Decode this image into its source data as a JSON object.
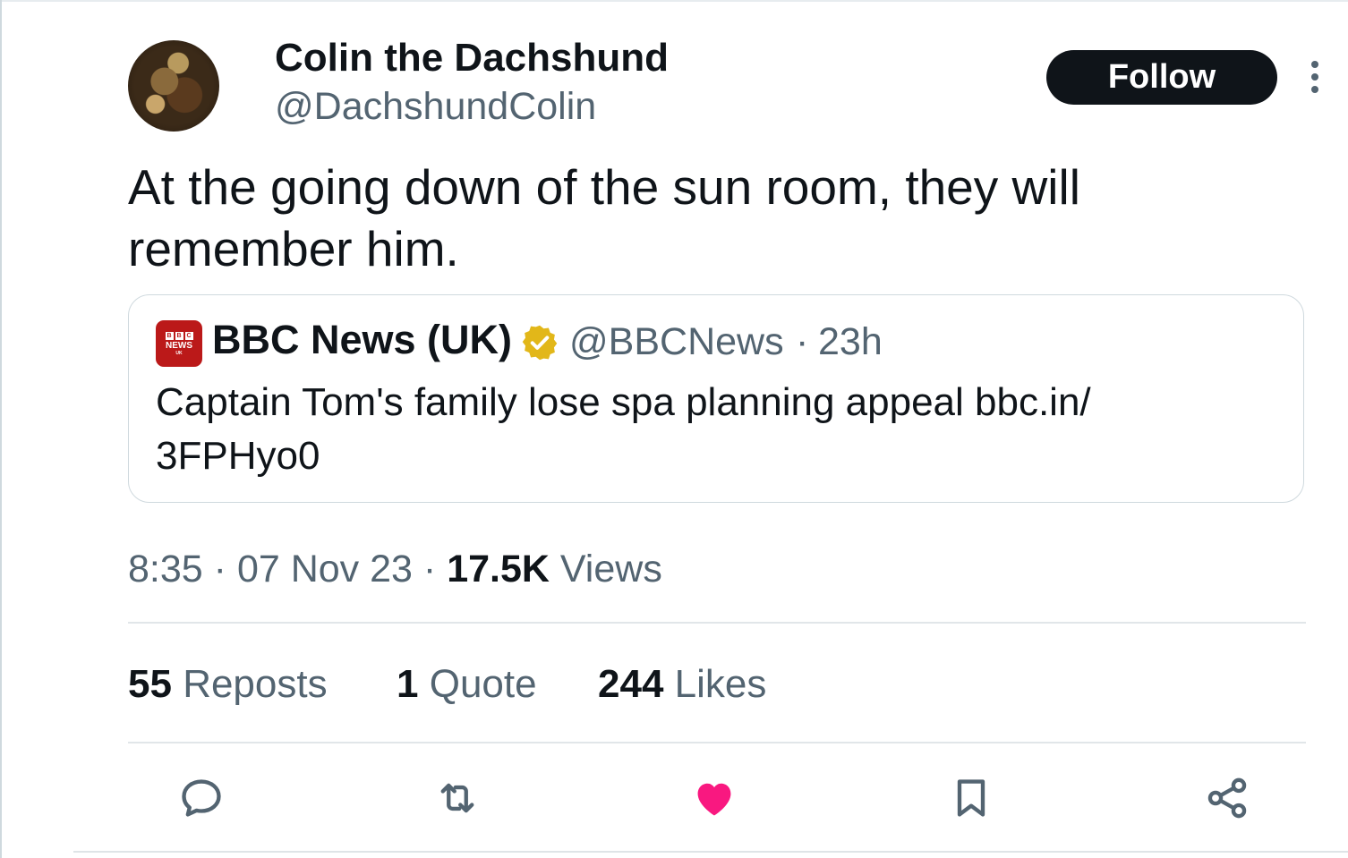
{
  "author": {
    "display_name": "Colin the Dachshund",
    "handle": "@DachshundColin"
  },
  "follow_label": "Follow",
  "tweet_text": "At the going down of the sun room, they will remember him.",
  "quoted": {
    "logo_text": "NEWS",
    "logo_sub": "UK",
    "name": "BBC News (UK)",
    "handle": "@BBCNews",
    "separator": "·",
    "time": "23h",
    "text": "Captain Tom's family lose spa planning appeal bbc.in/ 3FPHyo0"
  },
  "meta": {
    "time": "8:35",
    "date": "07 Nov 23",
    "views_count": "17.5K",
    "views_label": "Views",
    "separator": "·"
  },
  "stats": {
    "reposts_count": "55",
    "reposts_label": "Reposts",
    "quotes_count": "1",
    "quotes_label": "Quote",
    "likes_count": "244",
    "likes_label": "Likes"
  },
  "actions": [
    "reply-icon",
    "repost-icon",
    "like-icon",
    "bookmark-icon",
    "share-icon"
  ],
  "colors": {
    "text_primary": "#0f1419",
    "text_secondary": "#536471",
    "like_active": "#f91880",
    "verified_gold": "#e2b719",
    "bbc_red": "#bb1919"
  }
}
